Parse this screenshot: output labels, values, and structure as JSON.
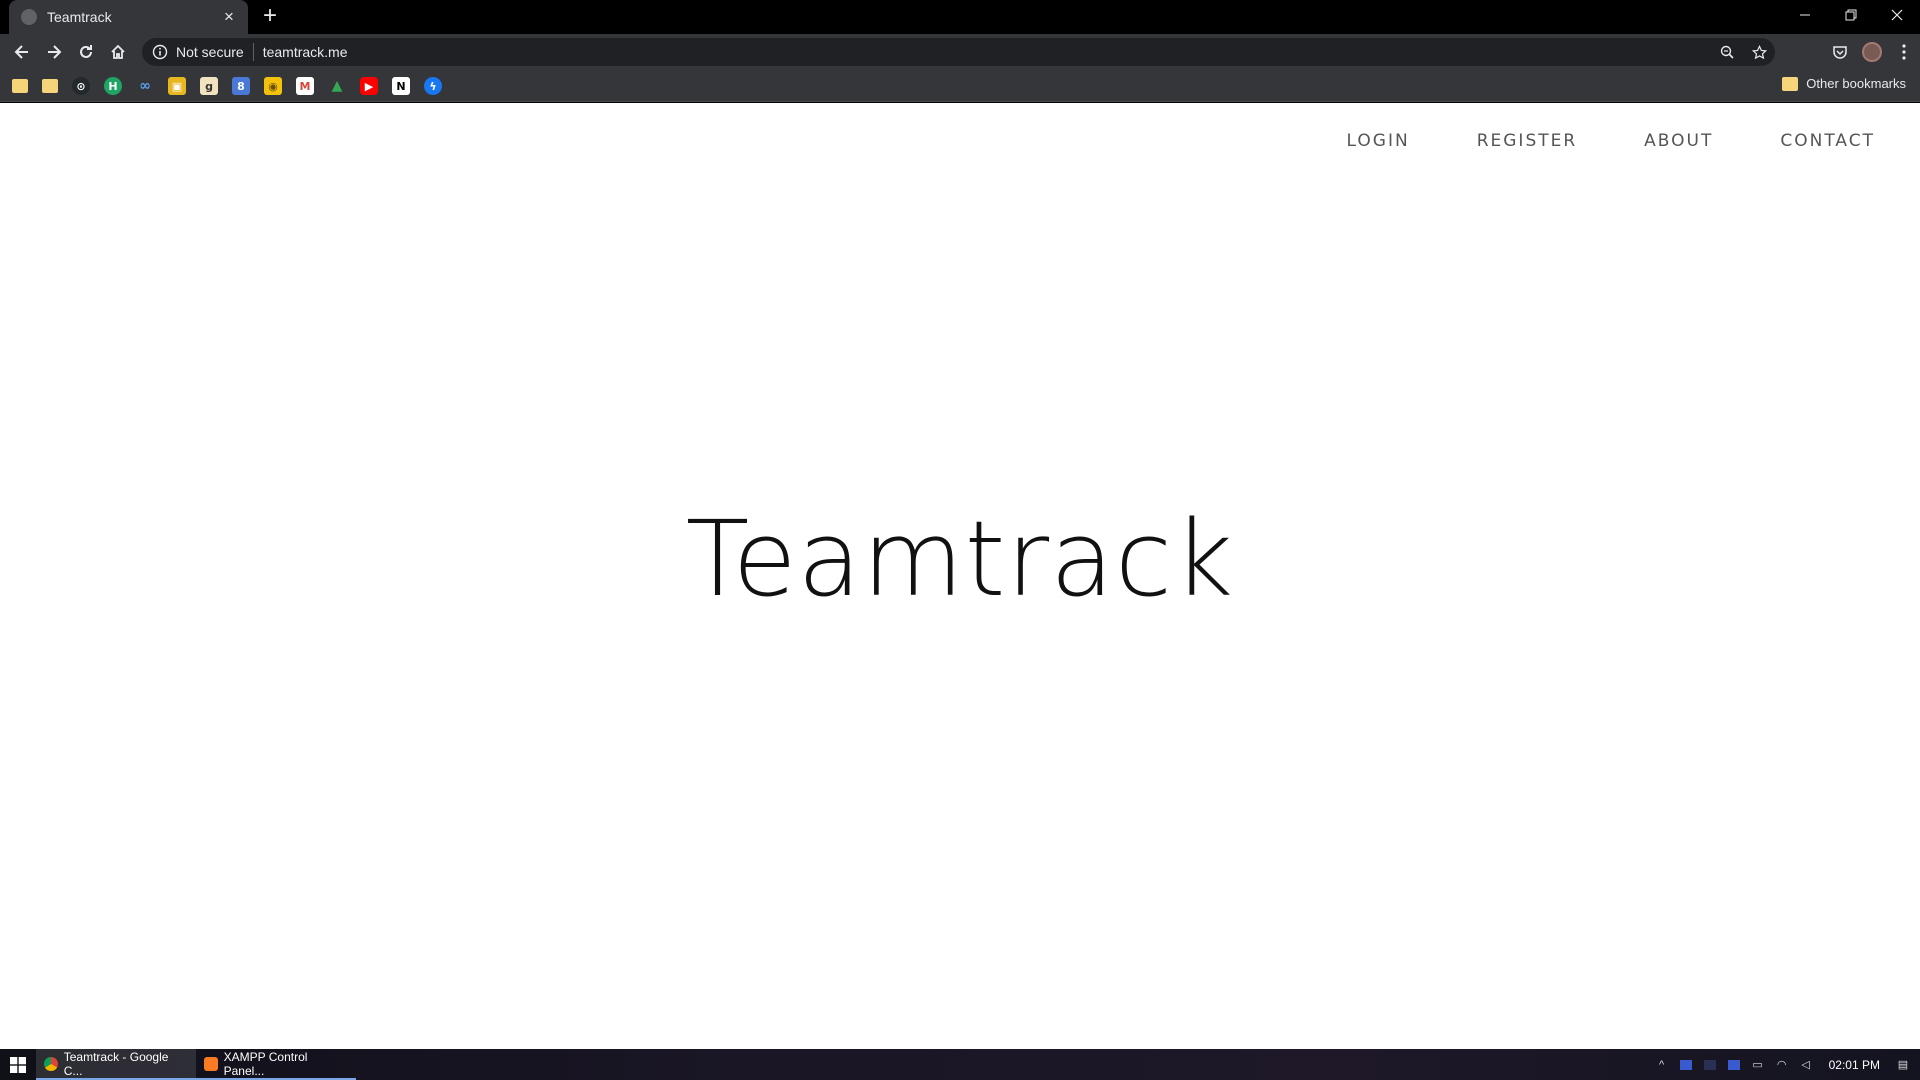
{
  "browser": {
    "tab": {
      "title": "Teamtrack"
    },
    "address": {
      "security_label": "Not secure",
      "url": "teamtrack.me"
    },
    "bookmarks": {
      "icons": [
        "bookmark-folder",
        "bookmark-folder",
        "github",
        "h-app",
        "infinity",
        "photo",
        "g-app",
        "8-app",
        "keep",
        "gmail",
        "google-drive",
        "youtube",
        "notion",
        "messenger"
      ],
      "other_label": "Other bookmarks"
    }
  },
  "site": {
    "nav": [
      "LOGIN",
      "REGISTER",
      "ABOUT",
      "CONTACT"
    ],
    "hero_title": "Teamtrack"
  },
  "taskbar": {
    "tasks": [
      "Teamtrack - Google C...",
      "XAMPP Control Panel..."
    ],
    "time": "02:01 PM"
  },
  "colors": {
    "chrome_dark": "#35363a",
    "page_bg": "#ffffff",
    "nav_text": "#555555"
  }
}
